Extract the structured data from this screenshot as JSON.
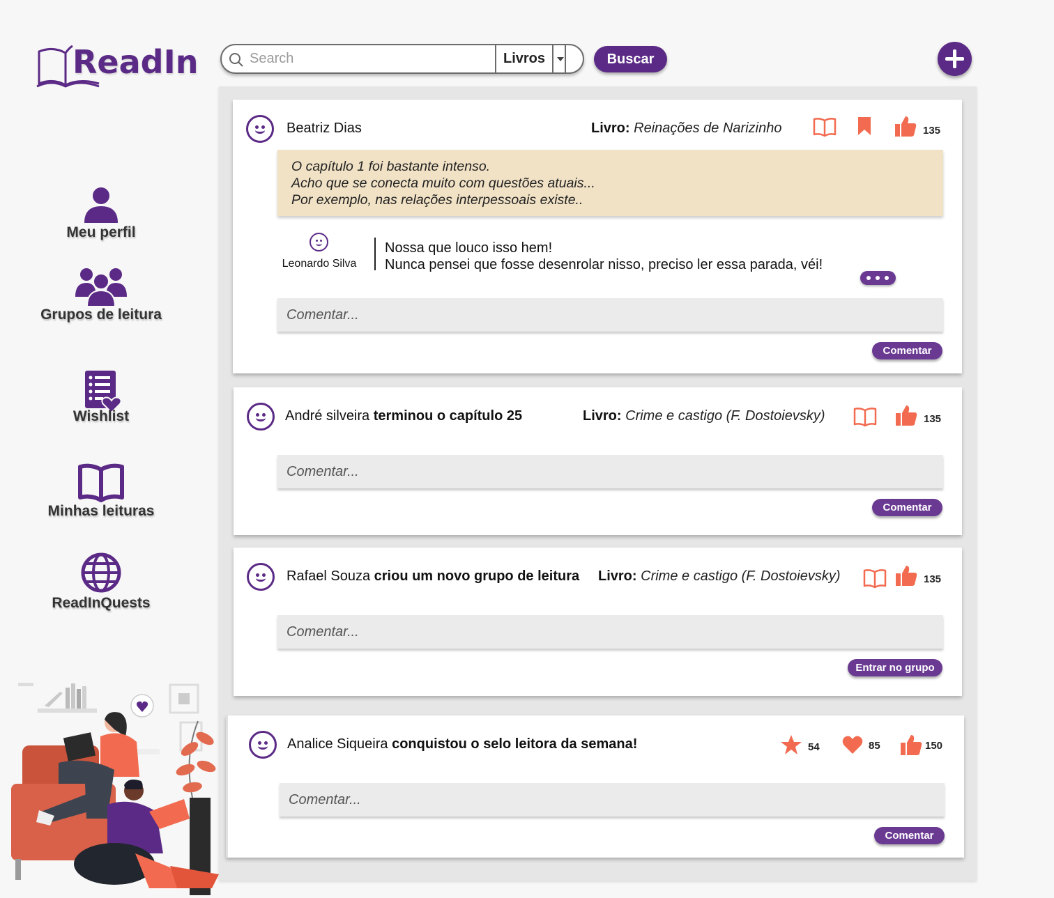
{
  "app": {
    "logo_text": "ReadIn"
  },
  "search": {
    "placeholder": "Search",
    "category": "Livros",
    "button": "Buscar"
  },
  "sidebar": {
    "items": [
      {
        "label": "Meu perfil"
      },
      {
        "label": "Grupos de leitura"
      },
      {
        "label": "Wishlist"
      },
      {
        "label": "Minhas leituras"
      },
      {
        "label": "ReadInQuests"
      }
    ]
  },
  "colors": {
    "brand": "#5b2a86",
    "accent": "#f26b50",
    "quote_bg": "#f1e2c6"
  },
  "posts": [
    {
      "user": "Beatriz Dias",
      "livro_label": "Livro:",
      "book": "Reinações de Narizinho",
      "likes": "135",
      "quote": [
        "O capítulo 1 foi bastante intenso.",
        "Acho que se conecta muito com questões atuais...",
        "Por exemplo, nas relações interpessoais existe.."
      ],
      "reply": {
        "user": "Leonardo Silva",
        "lines": [
          "Nossa que louco isso hem!",
          "Nunca pensei que fosse desenrolar nisso, preciso ler essa parada, véi!"
        ]
      },
      "comment_placeholder": "Comentar...",
      "button": "Comentar"
    },
    {
      "user": "André silveira",
      "action": "terminou o capítulo 25",
      "livro_label": "Livro:",
      "book": "Crime e castigo (F. Dostoievsky)",
      "likes": "135",
      "comment_placeholder": "Comentar...",
      "button": "Comentar"
    },
    {
      "user": "Rafael Souza",
      "action": "criou um novo grupo de leitura",
      "livro_label": "Livro:",
      "book": "Crime e castigo (F. Dostoievsky)",
      "likes": "135",
      "comment_placeholder": "Comentar...",
      "button": "Entrar no grupo"
    },
    {
      "user": "Analice Siqueira",
      "action": "conquistou o selo leitora da semana!",
      "stars": "54",
      "hearts": "85",
      "likes": "150",
      "comment_placeholder": "Comentar...",
      "button": "Comentar"
    }
  ]
}
